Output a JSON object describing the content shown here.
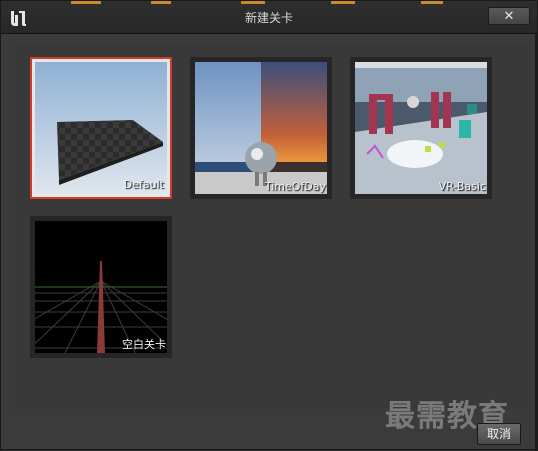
{
  "dialog": {
    "title": "新建关卡",
    "close_label": "✕",
    "cancel_label": "取消"
  },
  "templates": [
    {
      "label": "Default",
      "selected": true
    },
    {
      "label": "TimeOfDay",
      "selected": false
    },
    {
      "label": "VR-Basic",
      "selected": false
    },
    {
      "label": "空白关卡",
      "selected": false
    }
  ],
  "watermark": "最需教育",
  "colors": {
    "selection_border": "#d23a2a",
    "title_accent": "#c98a2a"
  }
}
